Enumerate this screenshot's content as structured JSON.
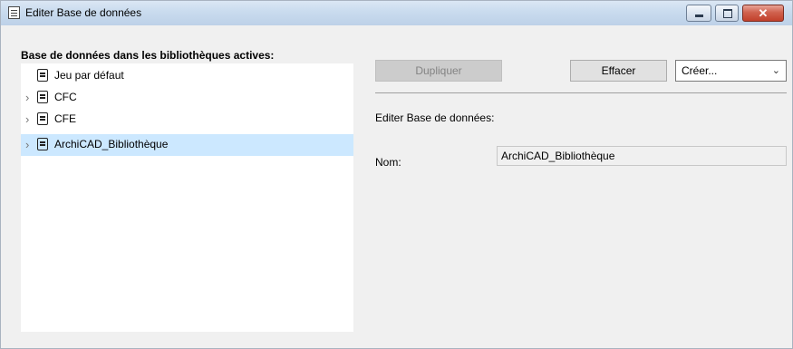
{
  "window": {
    "title": "Editer Base de données"
  },
  "left_panel": {
    "heading": "Base de données dans les bibliothèques actives:",
    "items": [
      {
        "label": "Jeu par défaut",
        "expandable": false,
        "selected": false
      },
      {
        "label": "CFC",
        "expandable": true,
        "selected": false
      },
      {
        "label": "CFE",
        "expandable": true,
        "selected": false
      },
      {
        "label": "ArchiCAD_Bibliothèque",
        "expandable": true,
        "selected": true
      }
    ]
  },
  "toolbar": {
    "dupliquer_label": "Dupliquer",
    "effacer_label": "Effacer",
    "creer_value": "Créer..."
  },
  "details": {
    "heading": "Editer Base de données:",
    "nom_label": "Nom:",
    "nom_value": "ArchiCAD_Bibliothèque"
  },
  "colors": {
    "selection": "#cce8ff",
    "close_button": "#c2402b"
  }
}
